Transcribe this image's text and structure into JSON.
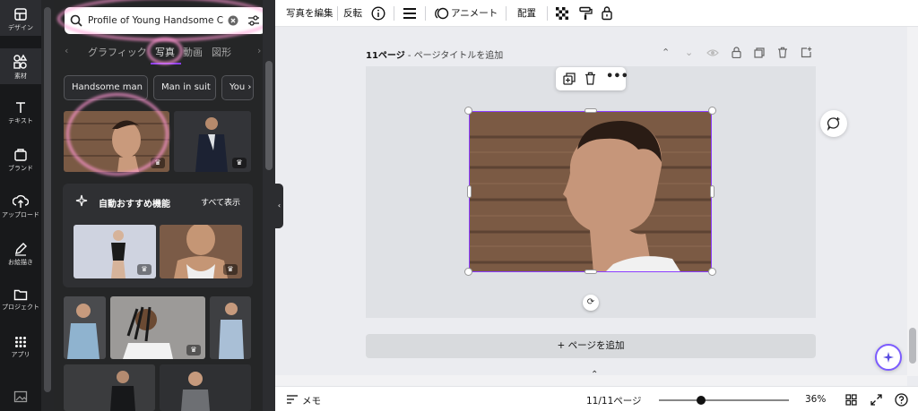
{
  "sidebar": {
    "items": [
      {
        "label": "デザイン",
        "icon": "layout-icon"
      },
      {
        "label": "素材",
        "icon": "elements-icon"
      },
      {
        "label": "テキスト",
        "icon": "text-icon"
      },
      {
        "label": "ブランド",
        "icon": "brand-icon"
      },
      {
        "label": "アップロード",
        "icon": "upload-icon"
      },
      {
        "label": "お絵描き",
        "icon": "draw-icon"
      },
      {
        "label": "プロジェクト",
        "icon": "folder-icon"
      },
      {
        "label": "アプリ",
        "icon": "apps-icon"
      }
    ]
  },
  "panel": {
    "search_value": "Profile of Young Handsome C",
    "tabs": [
      "グラフィック",
      "写真",
      "動画",
      "図形"
    ],
    "chips": [
      "Handsome man",
      "Man in suit",
      "You"
    ],
    "reco_title": "自動おすすめ機能",
    "reco_see_all": "すべて表示",
    "premium_badge": "♛"
  },
  "topbar": {
    "edit_photo": "写真を編集",
    "flip": "反転",
    "animate": "アニメート",
    "position": "配置"
  },
  "canvas": {
    "page_label": "11ページ",
    "page_title_placeholder": "ページタイトルを追加",
    "add_page": "+ ページを追加"
  },
  "bottombar": {
    "notes": "メモ",
    "page_count": "11/11ページ",
    "zoom": "36%"
  },
  "colors": {
    "accent": "#8b3dff",
    "sidebar_bg": "#18191b",
    "panel_bg": "#252627",
    "highlight_pink": "#ff96d2"
  }
}
